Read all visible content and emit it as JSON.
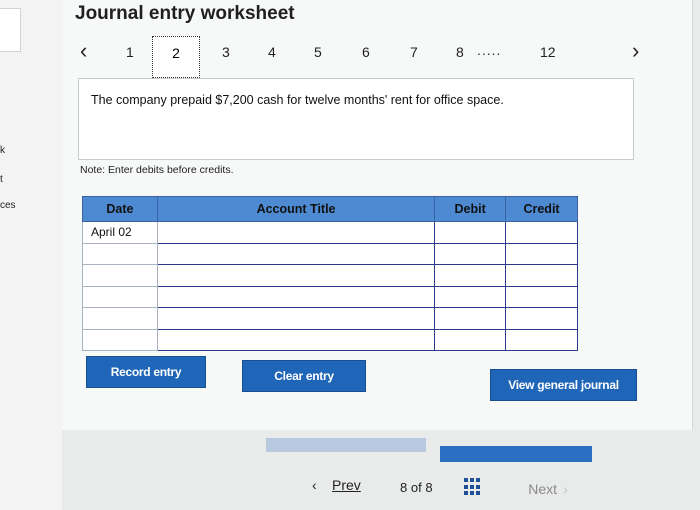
{
  "title": "Journal entry worksheet",
  "sidebar": {
    "labels": [
      "k",
      "t",
      "ces"
    ]
  },
  "pager": {
    "pages": [
      "1",
      "2",
      "3",
      "4",
      "5",
      "6",
      "7",
      "8",
      "12"
    ],
    "active": "2",
    "ellipsis": "....."
  },
  "question": "The company prepaid $7,200 cash for twelve months' rent for office space.",
  "note": "Note: Enter debits before credits.",
  "table": {
    "headers": [
      "Date",
      "Account Title",
      "Debit",
      "Credit"
    ],
    "rows": [
      {
        "date": "April 02",
        "account": "",
        "debit": "",
        "credit": ""
      },
      {
        "date": "",
        "account": "",
        "debit": "",
        "credit": ""
      },
      {
        "date": "",
        "account": "",
        "debit": "",
        "credit": ""
      },
      {
        "date": "",
        "account": "",
        "debit": "",
        "credit": ""
      },
      {
        "date": "",
        "account": "",
        "debit": "",
        "credit": ""
      },
      {
        "date": "",
        "account": "",
        "debit": "",
        "credit": ""
      }
    ]
  },
  "buttons": {
    "record": "Record entry",
    "clear": "Clear entry",
    "view_journal": "View general journal"
  },
  "footer": {
    "prev": "Prev",
    "page_current": "8",
    "page_of": "of",
    "page_total": "8",
    "next": "Next"
  },
  "colors": {
    "accent": "#1f66b8",
    "header_fill": "#4e8ad2"
  }
}
